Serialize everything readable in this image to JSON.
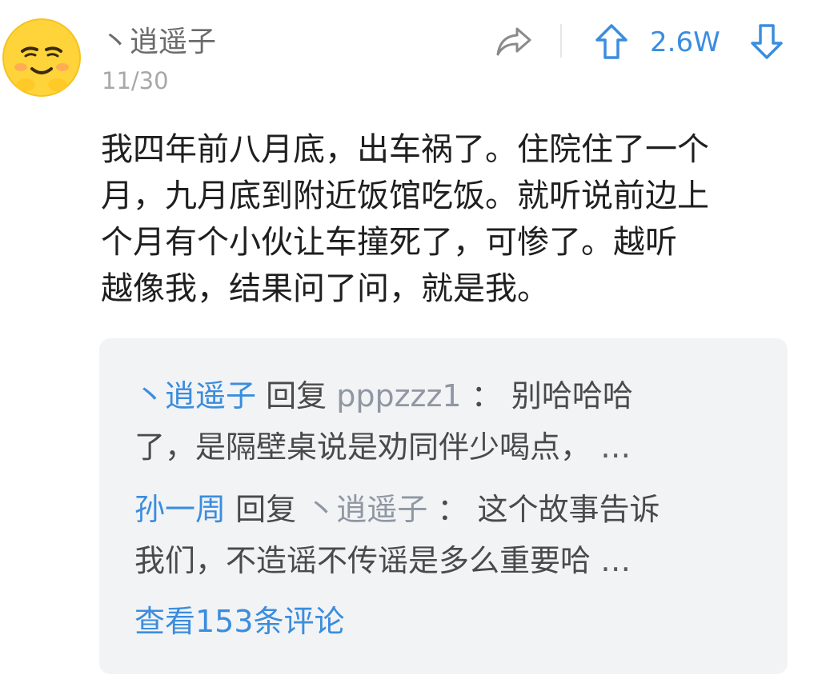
{
  "comment": {
    "author": "丶逍遥子",
    "date": "11/30",
    "vote_count": "2.6W",
    "body_lines": [
      "我四年前八月底，出车祸了。住院住了一个",
      "月，九月底到附近饭馆吃饭。就听说前边上",
      "个月有个小伙让车撞死了，可惨了。越听",
      "越像我，结果问了问，就是我。"
    ]
  },
  "replies": [
    {
      "author": "丶逍遥子",
      "verb": "回复",
      "target": "pppzzz1",
      "separator": "：",
      "line1_text": "别哈哈哈",
      "line2_text": "了，是隔壁桌说是劝同伴少喝点，",
      "ellipsis": "…"
    },
    {
      "author": "孙一周",
      "verb": "回复",
      "target": "丶逍遥子",
      "separator": "：",
      "line1_text": "这个故事告诉",
      "line2_text": "我们，不造谣不传谣是多么重要哈",
      "ellipsis": "…"
    }
  ],
  "view_more_label": "查看153条评论",
  "icons": {
    "share": "share-arrow-icon",
    "upvote": "arrow-up-icon",
    "downvote": "arrow-down-icon",
    "avatar": "emoji-face-avatar"
  },
  "colors": {
    "accent_blue": "#3b8ddd",
    "muted_gray": "#8f97a3",
    "panel_bg": "#f2f3f5",
    "avatar_yellow": "#ffd43a"
  }
}
